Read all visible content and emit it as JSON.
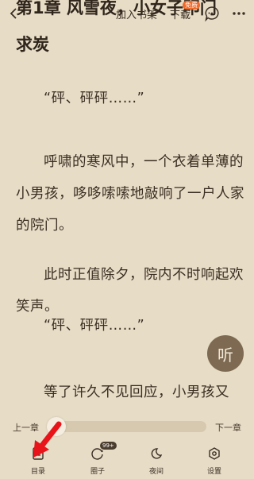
{
  "topbar": {
    "add_shelf": "加入书架",
    "download": "下载",
    "free_badge": "免费"
  },
  "chapter": {
    "title_line1": "第1章 风雪夜，小女子叩门",
    "title_line2": "求炭"
  },
  "paragraphs": [
    "“砰、砰砰……”",
    "呼啸的寒风中，一个衣着单薄的小男孩，哆哆嗦嗦地敲响了一户人家的院门。",
    "此时正值除夕，院内不时响起欢笑声。",
    "“砰、砰砰……”",
    "等了许久不见回应，小男孩又"
  ],
  "listen_button": "听",
  "progress": {
    "prev": "上一章",
    "next": "下一章",
    "position": 0.0
  },
  "tabs": [
    {
      "label": "目录",
      "icon": "catalog-icon"
    },
    {
      "label": "圈子",
      "icon": "circle-icon",
      "badge": "99+"
    },
    {
      "label": "夜间",
      "icon": "moon-icon"
    },
    {
      "label": "设置",
      "icon": "settings-icon"
    }
  ],
  "colors": {
    "background": "#e7dcc6",
    "accent_badge": "#f06a2a",
    "listen_button": "#7e6a52",
    "arrow": "#e8141a"
  }
}
